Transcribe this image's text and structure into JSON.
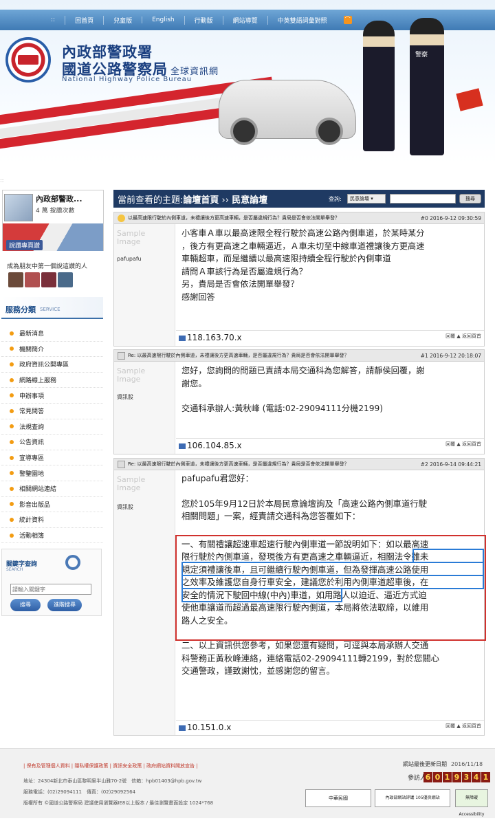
{
  "nav": {
    "items": [
      "回首頁",
      "兒童版",
      "English",
      "行動版",
      "網站導覽",
      "中英雙語詞彙對照"
    ],
    "leading": "::",
    "rss": "RSS"
  },
  "header": {
    "title1": "內政部警政署",
    "title2": "國道公路警察局",
    "title2_suffix": "全球資訊網",
    "title_en": "National Highway Police Bureau",
    "police_label": "警察"
  },
  "page_dots": "::",
  "facebook": {
    "name": "內政部警政...",
    "likes": "4 萬 按讚次數",
    "like_button": "說讚專頁讚",
    "friends": "成為朋友中第一個說這讚的人"
  },
  "service": {
    "title": "服務分類",
    "subtitle": "SERVICE",
    "items": [
      "最新消息",
      "機關簡介",
      "政府資訊公開專區",
      "網路線上服務",
      "申辦事項",
      "常見問答",
      "法規查詢",
      "公告資訊",
      "宣導專區",
      "警鑒園地",
      "相關網站連結",
      "影音出版品",
      "統計資料",
      "活動相簿"
    ]
  },
  "keyword": {
    "title": "關鍵字查詢",
    "subtitle": "SEARCH",
    "placeholder": "請輸入關鍵字",
    "search_button": "搜尋",
    "advanced_button": "進階搜尋"
  },
  "board": {
    "current_label": "當前查看的主題:",
    "forum": "論壇首頁",
    "sep": " ›› ",
    "section": "民意論壇",
    "query_label": "查詢:",
    "select_value": "民意論壇",
    "search_button": "搜尋"
  },
  "posts": [
    {
      "title": "以最高速限行駛於內側車道，未禮讓後方更高速車輛，是否屬違規行為？貴局是否會依法開單舉發？",
      "meta": "#0 2016-9-12 09:30:59",
      "sample": "Sample Image",
      "author": "pafupafu",
      "lines": [
        "小客車Ａ車以最高速限全程行駛於高速公路內側車道，於某時某分",
        "，後方有更高速之車輛逼近，Ａ車未切至中線車道禮讓後方更高速",
        "車輛超車，而是繼續以最高速限持續全程行駛於內側車道",
        "請問Ａ車該行為是否屬違規行為？",
        "另，貴局是否會依法開單舉發？",
        "感謝回答"
      ],
      "ip": "118.163.70.x",
      "reply": "回覆",
      "top": "返回頁首"
    },
    {
      "title": "Re: 以最高速限行駛於內側車道，未禮讓後方更高速車輛，是否屬違規行為？貴局是否會依法開單舉發？",
      "meta": "#1 2016-9-12 20:18:07",
      "sample": "Sample Image",
      "author": "資訊股",
      "lines": [
        "您好，您詢問的問題已責請本局交通科為您解答，請靜侯回覆，謝",
        "謝您。",
        "",
        "交通科承辦人:黃秋峰 (電話:02-29094111分機2199)"
      ],
      "ip": "106.104.85.x",
      "reply": "回覆",
      "top": "返回頁首"
    },
    {
      "title": "Re: 以最高速限行駛於內側車道，未禮讓後方更高速車輛，是否屬違規行為？貴局是否會依法開單舉發？",
      "meta": "#2 2016-9-14 09:44:21",
      "sample": "Sample Image",
      "author": "資訊股",
      "lines": [
        "pafupafu君您好：",
        "",
        "您於105年9月12日於本局民意論壇詢及「高速公路內側車道行駛",
        "相關問題」一案，經責請交通科為您答覆如下：",
        "",
        "一、有關禮讓超速車超速行駛內側車道一節說明如下：如以最高速",
        "限行駛於內側車道，發現後方有更高速之車輛逼近，相關法令雖未",
        "規定須禮讓後車，且可繼續行駛內側車道，但為發揮高速公路使用",
        "之效率及維護您自身行車安全，建議您於利用內側車道超車後，在",
        "安全的情況下駛回中線(中內)車道，如用路人以迫近、逼近方式迫",
        "使他車讓道而超過最高速限行駛內側道，本局將依法取締，以維用",
        "路人之安全。",
        "",
        "二、以上資訊供您參考，如果您還有疑問，可逕與本局承辦人交通",
        "科警務正黃秋峰連絡，連絡電話02-29094111轉2199，對於您關心",
        "交通警政，謹致謝忱，並感謝您的留言。"
      ],
      "ip": "10.151.0.x",
      "reply": "回覆",
      "top": "返回頁首"
    }
  ],
  "footer": {
    "links": "| 保有及管理個人資料 | 隱私權保護政策 | 資訊安全政策 | 政府網站資料開放宣告 |",
    "address": "地址：24304新北市泰山區黎明里半山雅70-2號　信箱：hpb01403@hpb.gov.tw",
    "phone": "服務電話：(02)29094111　傳真：(02)29092564",
    "copyright": "版權所有 ©國道公路警察局 建議使用瀏覽器IE8以上版本 / 最佳瀏覽畫面設定 1024*768",
    "update_label": "網站最後更新日期",
    "update_date": "2016/11/18",
    "visitors_label": "參訪人數",
    "visitors": [
      "6",
      "0",
      "1",
      "9",
      "3",
      "4",
      "1"
    ],
    "badges": [
      "中華民國",
      "內政部網站評議 105優良網站",
      "無障礙 Accessibility"
    ]
  }
}
